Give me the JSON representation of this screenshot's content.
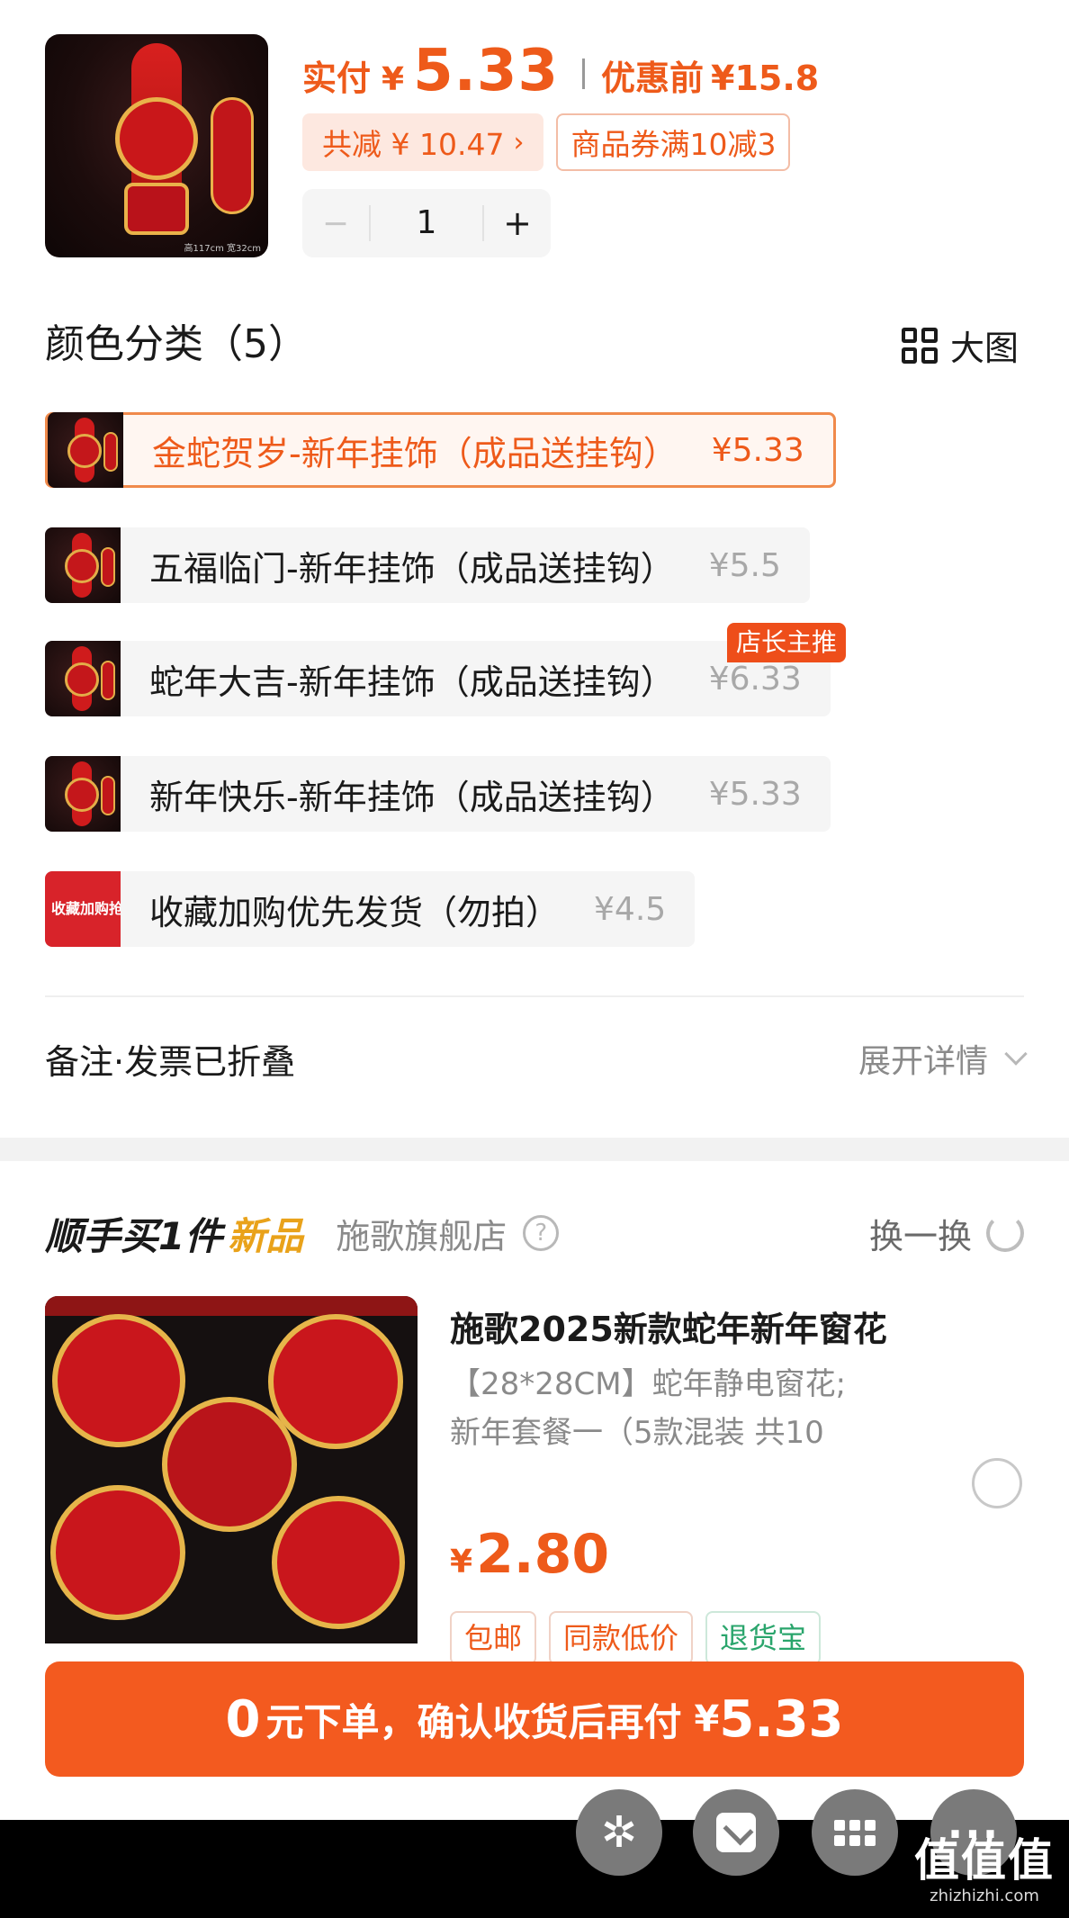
{
  "header": {
    "paid_label": "实付",
    "paid_yen": "¥",
    "paid_amount": "5.33",
    "before_label": "优惠前",
    "before_amount": "¥15.8",
    "saved_chip": "共减 ¥ 10.47",
    "coupon_chip": "商品券满10减3",
    "quantity": "1",
    "thumb_dim_text": "高117cm  宽32cm"
  },
  "color_section": {
    "title": "颜色分类（5）",
    "big_image_label": "大图",
    "recommend_badge": "店长主推",
    "options": [
      {
        "name": "金蛇贺岁-新年挂饰（成品送挂钩）",
        "price": "¥5.33",
        "selected": true
      },
      {
        "name": "五福临门-新年挂饰（成品送挂钩）",
        "price": "¥5.5",
        "selected": false
      },
      {
        "name": "蛇年大吉-新年挂饰（成品送挂钩）",
        "price": "¥6.33",
        "selected": false
      },
      {
        "name": "新年快乐-新年挂饰（成品送挂钩）",
        "price": "¥5.33",
        "selected": false
      },
      {
        "name": "收藏加购优先发货（勿拍）",
        "price": "¥4.5",
        "selected": false,
        "thumb_text": "收藏加购抢先发货"
      }
    ]
  },
  "note_row": {
    "label": "备注·发票已折叠",
    "expand_label": "展开详情"
  },
  "addon": {
    "heading_main": "顺手买1件",
    "heading_tag": "新品",
    "store_name": "施歌旗舰店",
    "help_glyph": "?",
    "swap_label": "换一换",
    "product_title": "施歌2025新款蛇年新年窗花",
    "product_desc_line1": "【28*28CM】蛇年静电窗花;",
    "product_desc_line2": "新年套餐一（5款混装 共10",
    "price_yen": "¥",
    "price_amount": "2.80",
    "tags": [
      "包邮",
      "同款低价",
      "退货宝"
    ]
  },
  "cta": {
    "zero": "0",
    "text": "元下单，确认收货后再付",
    "yen": "¥",
    "amount": "5.33"
  },
  "watermark": {
    "logo": "值值值",
    "url": "zhizhizhi.com"
  },
  "colors": {
    "accent": "#ee5a1a",
    "cta": "#f35a1f",
    "new_tag": "#e9a21a",
    "green_tag": "#2aa56c"
  },
  "icons": {
    "fab1": "pinwheel-icon",
    "fab2": "download-icon",
    "fab3": "apps-grid-icon",
    "fab4": "more-dots-icon"
  }
}
